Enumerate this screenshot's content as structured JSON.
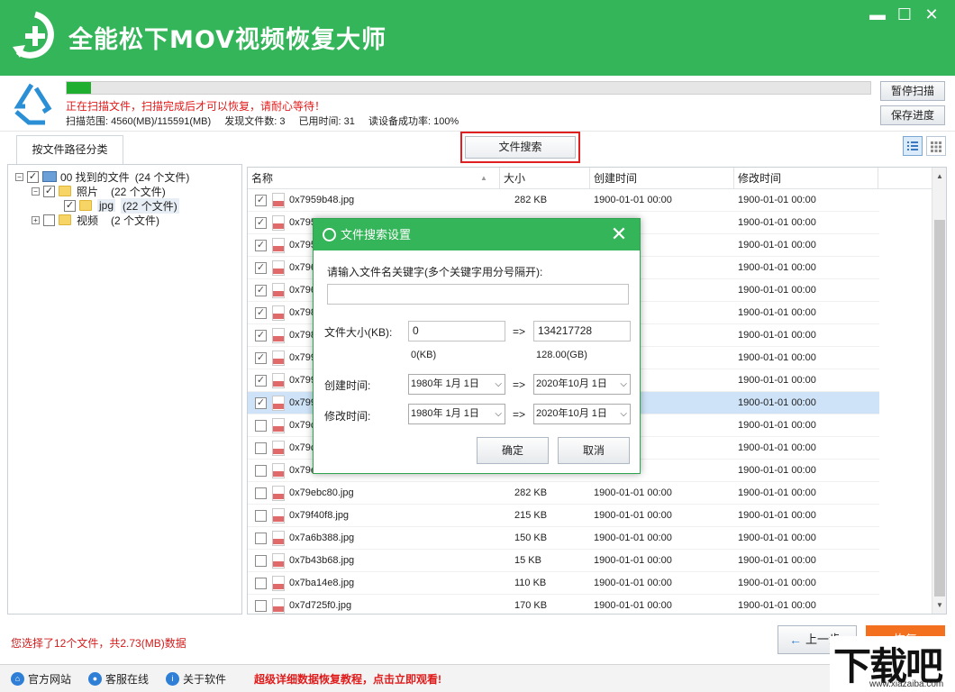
{
  "app": {
    "title": "全能松下MOV视频恢复大师"
  },
  "window": {
    "minimize": "▬",
    "maximize": "☐",
    "close": "✕"
  },
  "scan": {
    "progress_percent": 3,
    "status": "正在扫描文件，扫描完成后才可以恢复，请耐心等待！",
    "range": "扫描范围: 4560(MB)/115591(MB)",
    "found": "发现文件数: 3",
    "elapsed": "已用时间: 31",
    "success_rate": "读设备成功率: 100%",
    "pause_label": "暂停扫描",
    "save_label": "保存进度"
  },
  "tabs": {
    "by_path": "按文件路径分类",
    "file_search": "文件搜索"
  },
  "tree": {
    "root": {
      "label": "00 找到的文件",
      "count": "(24 个文件)"
    },
    "photos": {
      "label": "照片",
      "count": "(22 个文件)"
    },
    "jpg": {
      "label": "jpg",
      "count": "(22 个文件)"
    },
    "videos": {
      "label": "视频",
      "count": "(2 个文件)"
    }
  },
  "table": {
    "columns": {
      "name": "名称",
      "size": "大小",
      "created": "创建时间",
      "modified": "修改时间"
    },
    "rows": [
      {
        "name": "0x7959b48.jpg",
        "size": "282 KB",
        "created": "1900-01-01  00:00",
        "modified": "1900-01-01  00:00",
        "checked": true
      },
      {
        "name": "0x795",
        "size": "",
        "created": "",
        "modified": "1900-01-01  00:00",
        "checked": true
      },
      {
        "name": "0x795",
        "size": "",
        "created": "",
        "modified": "1900-01-01  00:00",
        "checked": true
      },
      {
        "name": "0x796",
        "size": "",
        "created": "",
        "modified": "1900-01-01  00:00",
        "checked": true
      },
      {
        "name": "0x796",
        "size": "",
        "created": "",
        "modified": "1900-01-01  00:00",
        "checked": true
      },
      {
        "name": "0x798",
        "size": "",
        "created": "",
        "modified": "1900-01-01  00:00",
        "checked": true
      },
      {
        "name": "0x798",
        "size": "",
        "created": "",
        "modified": "1900-01-01  00:00",
        "checked": true
      },
      {
        "name": "0x799",
        "size": "",
        "created": "",
        "modified": "1900-01-01  00:00",
        "checked": true
      },
      {
        "name": "0x799",
        "size": "",
        "created": "",
        "modified": "1900-01-01  00:00",
        "checked": true
      },
      {
        "name": "0x799",
        "size": "",
        "created": "",
        "modified": "1900-01-01  00:00",
        "checked": true
      },
      {
        "name": "0x79c",
        "size": "",
        "created": "",
        "modified": "1900-01-01  00:00",
        "checked": false
      },
      {
        "name": "0x79c",
        "size": "",
        "created": "",
        "modified": "1900-01-01  00:00",
        "checked": false
      },
      {
        "name": "0x79e",
        "size": "",
        "created": "",
        "modified": "1900-01-01  00:00",
        "checked": false
      },
      {
        "name": "0x79ebc80.jpg",
        "size": "282 KB",
        "created": "1900-01-01  00:00",
        "modified": "1900-01-01  00:00",
        "checked": false
      },
      {
        "name": "0x79f40f8.jpg",
        "size": "215 KB",
        "created": "1900-01-01  00:00",
        "modified": "1900-01-01  00:00",
        "checked": false
      },
      {
        "name": "0x7a6b388.jpg",
        "size": "150 KB",
        "created": "1900-01-01  00:00",
        "modified": "1900-01-01  00:00",
        "checked": false
      },
      {
        "name": "0x7b43b68.jpg",
        "size": "15 KB",
        "created": "1900-01-01  00:00",
        "modified": "1900-01-01  00:00",
        "checked": false
      },
      {
        "name": "0x7ba14e8.jpg",
        "size": "110 KB",
        "created": "1900-01-01  00:00",
        "modified": "1900-01-01  00:00",
        "checked": false
      },
      {
        "name": "0x7d725f0.jpg",
        "size": "170 KB",
        "created": "1900-01-01  00:00",
        "modified": "1900-01-01  00:00",
        "checked": false
      }
    ]
  },
  "bottom": {
    "selection_info": "您选择了12个文件，共2.73(MB)数据",
    "prev_label": "上一步",
    "recover_label": "恢复"
  },
  "footer": {
    "website": "官方网站",
    "support": "客服在线",
    "about": "关于软件",
    "promo": "超级详细数据恢复教程，点击立即观看!"
  },
  "watermark": {
    "text": "下载吧",
    "url": "www.xiazaiba.com"
  },
  "dialog": {
    "title": "文件搜索设置",
    "close": "✕",
    "keyword_label": "请输入文件名关键字(多个关键字用分号隔开):",
    "keyword_value": "",
    "size_label": "文件大小(KB):",
    "size_min": "0",
    "size_arrow": "=>",
    "size_max": "134217728",
    "size_min_hint": "0(KB)",
    "size_max_hint": "128.00(GB)",
    "created_label": "创建时间:",
    "created_from": "1980年  1月  1日",
    "created_to": "2020年10月  1日",
    "modified_label": "修改时间:",
    "modified_from": "1980年  1月  1日",
    "modified_to": "2020年10月  1日",
    "ok_label": "确定",
    "cancel_label": "取消"
  }
}
